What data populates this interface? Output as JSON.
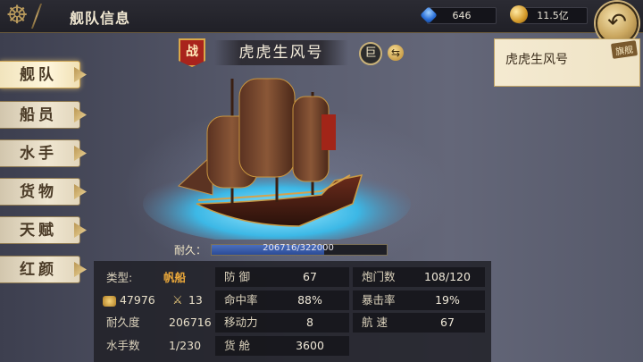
{
  "header": {
    "title": "舰队信息",
    "gems": "646",
    "gold": "11.5亿"
  },
  "sidebar": {
    "items": [
      {
        "label": "舰队"
      },
      {
        "label": "船员"
      },
      {
        "label": "水手"
      },
      {
        "label": "货物"
      },
      {
        "label": "天赋"
      },
      {
        "label": "红颜"
      }
    ],
    "active_index": 0
  },
  "ship": {
    "war_badge": "战",
    "name": "虎虎生风号",
    "size_badge": "巨",
    "durability_label": "耐久：",
    "durability_text": "206716/322000",
    "durability_current": 206716,
    "durability_max": 322000
  },
  "stats": {
    "type_label": "类型:",
    "type_value": "帆船",
    "troops": "47976",
    "attack": "13",
    "durability_label": "耐久度",
    "durability_value": "206716",
    "sailors_label": "水手数",
    "sailors_value": "1/230",
    "defense_label": "防 御",
    "defense_value": "67",
    "accuracy_label": "命中率",
    "accuracy_value": "88%",
    "mobility_label": "移动力",
    "mobility_value": "8",
    "cargo_label": "货 舱",
    "cargo_value": "3600",
    "cannon_label": "炮门数",
    "cannon_value": "108/120",
    "crit_label": "暴击率",
    "crit_value": "19%",
    "speed_label": "航 速",
    "speed_value": "67"
  },
  "fleet_list": [
    {
      "name": "虎虎生风号",
      "tag": "旗舰"
    }
  ],
  "colors": {
    "accent_gold": "#c9a765",
    "type_orange": "#e9a73a",
    "durability_blue": "#3a5cab"
  }
}
